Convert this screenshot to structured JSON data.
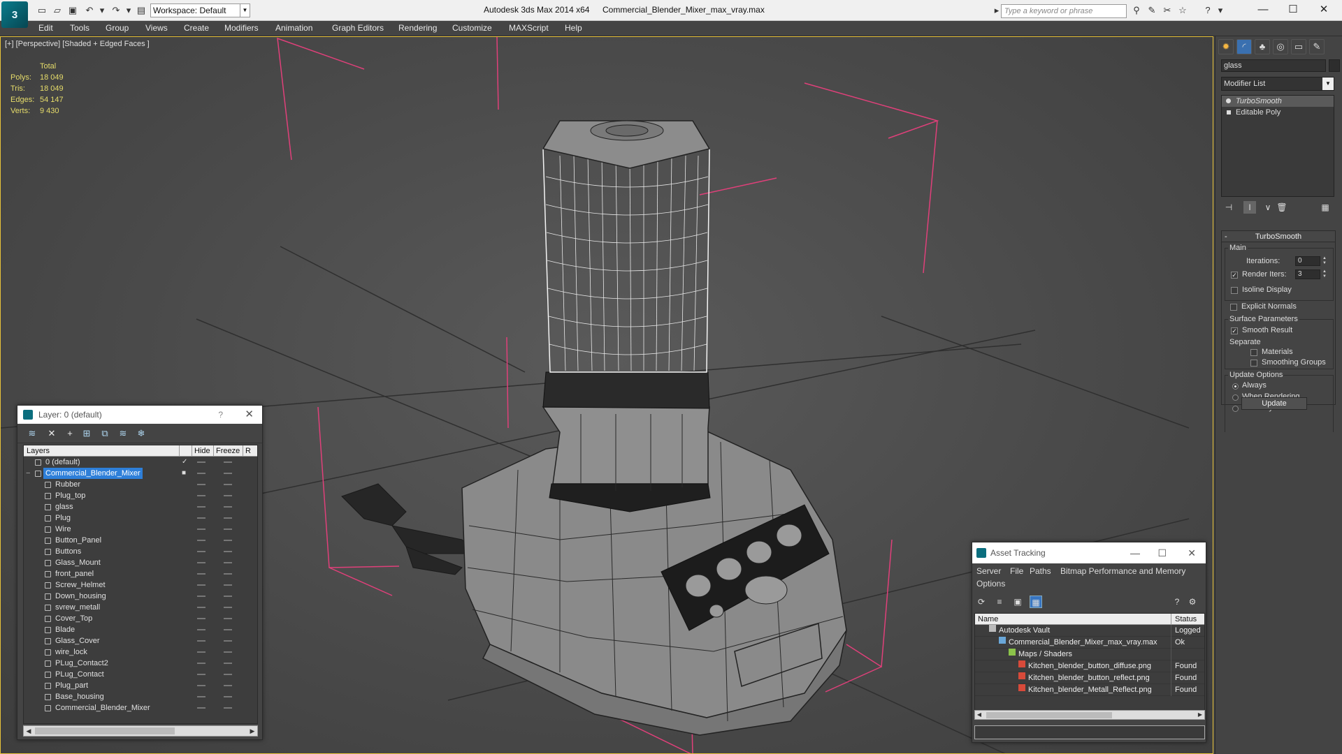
{
  "titlebar": {
    "workspace_label": "Workspace: Default",
    "app_title": "Autodesk 3ds Max  2014 x64",
    "file_title": "Commercial_Blender_Mixer_max_vray.max",
    "search_placeholder": "Type a keyword or phrase"
  },
  "menu": [
    "Edit",
    "Tools",
    "Group",
    "Views",
    "Create",
    "Modifiers",
    "Animation",
    "Graph Editors",
    "Rendering",
    "Customize",
    "MAXScript",
    "Help"
  ],
  "viewport": {
    "label": "[+] [Perspective] [Shaded + Edged Faces ]",
    "stats": {
      "header": "Total",
      "rows": [
        {
          "key": "Polys:",
          "value": "18 049"
        },
        {
          "key": "Tris:",
          "value": "18 049"
        },
        {
          "key": "Edges:",
          "value": "54 147"
        },
        {
          "key": "Verts:",
          "value": "9 430"
        }
      ]
    }
  },
  "command_panel": {
    "object_name": "glass",
    "modifier_list_label": "Modifier List",
    "stack": [
      {
        "label": "TurboSmooth",
        "selected": true,
        "icon": "bulb-icon"
      },
      {
        "label": "Editable Poly",
        "selected": false,
        "icon": "square-icon"
      }
    ],
    "rollout": {
      "title": "TurboSmooth",
      "main_group": "Main",
      "iterations_label": "Iterations:",
      "iterations_value": "0",
      "render_iters_label": "Render Iters:",
      "render_iters_value": "3",
      "render_iters_checked": true,
      "isoline_label": "Isoline Display",
      "explicit_normals_label": "Explicit Normals",
      "surface_group": "Surface Parameters",
      "smooth_result_label": "Smooth Result",
      "separate_label": "Separate",
      "materials_label": "Materials",
      "smoothing_groups_label": "Smoothing Groups",
      "update_group": "Update Options",
      "always_label": "Always",
      "when_rendering_label": "When Rendering",
      "manually_label": "Manually",
      "update_button": "Update"
    }
  },
  "layer_window": {
    "title": "Layer: 0 (default)",
    "help": "?",
    "columns": {
      "layers": "Layers",
      "hide": "Hide",
      "freeze": "Freeze",
      "extra": "R"
    },
    "rows": [
      {
        "name": "0 (default)",
        "level": 0,
        "selected": false,
        "check": "✓"
      },
      {
        "name": "Commercial_Blender_Mixer",
        "level": 0,
        "selected": true,
        "check": "■"
      },
      {
        "name": "Rubber",
        "level": 1
      },
      {
        "name": "Plug_top",
        "level": 1
      },
      {
        "name": "glass",
        "level": 1
      },
      {
        "name": "Plug",
        "level": 1
      },
      {
        "name": "Wire",
        "level": 1
      },
      {
        "name": "Button_Panel",
        "level": 1
      },
      {
        "name": "Buttons",
        "level": 1
      },
      {
        "name": "Glass_Mount",
        "level": 1
      },
      {
        "name": "front_panel",
        "level": 1
      },
      {
        "name": "Screw_Helmet",
        "level": 1
      },
      {
        "name": "Down_housing",
        "level": 1
      },
      {
        "name": "svrew_metall",
        "level": 1
      },
      {
        "name": "Cover_Top",
        "level": 1
      },
      {
        "name": "Blade",
        "level": 1
      },
      {
        "name": "Glass_Cover",
        "level": 1
      },
      {
        "name": "wire_lock",
        "level": 1
      },
      {
        "name": "PLug_Contact2",
        "level": 1
      },
      {
        "name": "PLug_Contact",
        "level": 1
      },
      {
        "name": "Plug_part",
        "level": 1
      },
      {
        "name": "Base_housing",
        "level": 1
      },
      {
        "name": "Commercial_Blender_Mixer",
        "level": 1
      }
    ]
  },
  "asset_window": {
    "title": "Asset Tracking",
    "menu": [
      "Server",
      "File",
      "Paths",
      "Bitmap Performance and Memory",
      "Options"
    ],
    "columns": {
      "name": "Name",
      "status": "Status"
    },
    "rows": [
      {
        "name": "Autodesk Vault",
        "status": "Logged",
        "level": 0,
        "icon": "vault-icon"
      },
      {
        "name": "Commercial_Blender_Mixer_max_vray.max",
        "status": "Ok",
        "level": 1,
        "icon": "max-file-icon"
      },
      {
        "name": "Maps / Shaders",
        "status": "",
        "level": 2,
        "icon": "folder-icon"
      },
      {
        "name": "Kitchen_blender_button_diffuse.png",
        "status": "Found",
        "level": 3,
        "icon": "png-icon"
      },
      {
        "name": "Kitchen_blender_button_reflect.png",
        "status": "Found",
        "level": 3,
        "icon": "png-icon"
      },
      {
        "name": "Kitchen_blender_Metall_Reflect.png",
        "status": "Found",
        "level": 3,
        "icon": "png-icon"
      }
    ]
  },
  "colors": {
    "viewport_border": "#e8c33a",
    "stats_text": "#e6dc6a",
    "selection": "#2e7fd9",
    "bounding_box": "#e0407a",
    "brand": "#0b6e7e"
  }
}
